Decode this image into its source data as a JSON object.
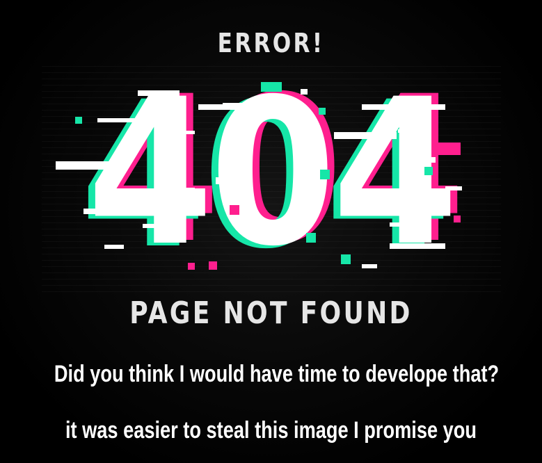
{
  "graphic": {
    "title": "ERROR!",
    "code": "404",
    "subtitle": "PAGE NOT FOUND",
    "colors": {
      "background": "#000000",
      "text": "#ffffff",
      "glitch_pink": "#ff1f8e",
      "glitch_green": "#16e6a8"
    }
  },
  "captions": {
    "line1": "Did you think I would have time to develope that?",
    "line2": "it was easier to steal this image I promise you"
  }
}
